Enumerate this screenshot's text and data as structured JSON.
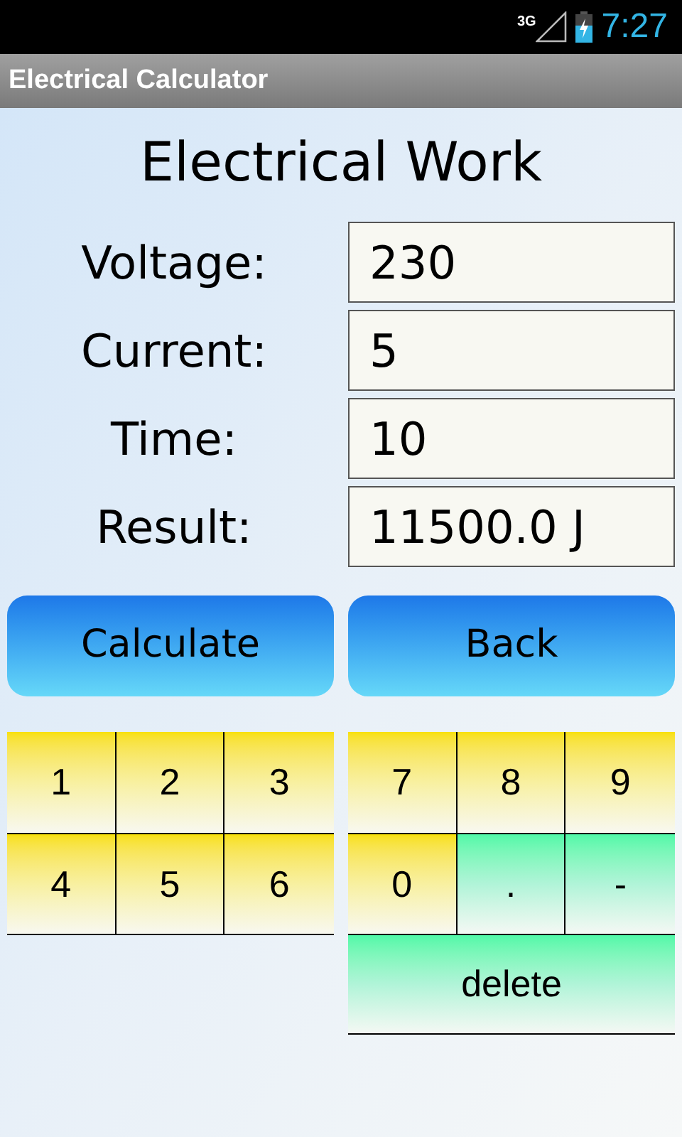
{
  "status_bar": {
    "network": "3G",
    "time": "7:27"
  },
  "app_bar": {
    "title": "Electrical Calculator"
  },
  "heading": "Electrical Work",
  "fields": [
    {
      "label": "Voltage:",
      "value": "230"
    },
    {
      "label": "Current:",
      "value": "5"
    },
    {
      "label": "Time:",
      "value": "10"
    },
    {
      "label": "Result:",
      "value": "11500.0 J"
    }
  ],
  "buttons": [
    "Calculate",
    "Back"
  ],
  "keypad_left": [
    {
      "label": "1",
      "kind": "digit"
    },
    {
      "label": "2",
      "kind": "digit"
    },
    {
      "label": "3",
      "kind": "digit"
    },
    {
      "label": "4",
      "kind": "digit"
    },
    {
      "label": "5",
      "kind": "digit"
    },
    {
      "label": "6",
      "kind": "digit"
    }
  ],
  "keypad_right": [
    {
      "label": "7",
      "kind": "digit"
    },
    {
      "label": "8",
      "kind": "digit"
    },
    {
      "label": "9",
      "kind": "digit"
    },
    {
      "label": "0",
      "kind": "digit"
    },
    {
      "label": ".",
      "kind": "symbol"
    },
    {
      "label": "-",
      "kind": "symbol"
    }
  ],
  "delete_key": {
    "label": "delete",
    "kind": "symbol"
  }
}
